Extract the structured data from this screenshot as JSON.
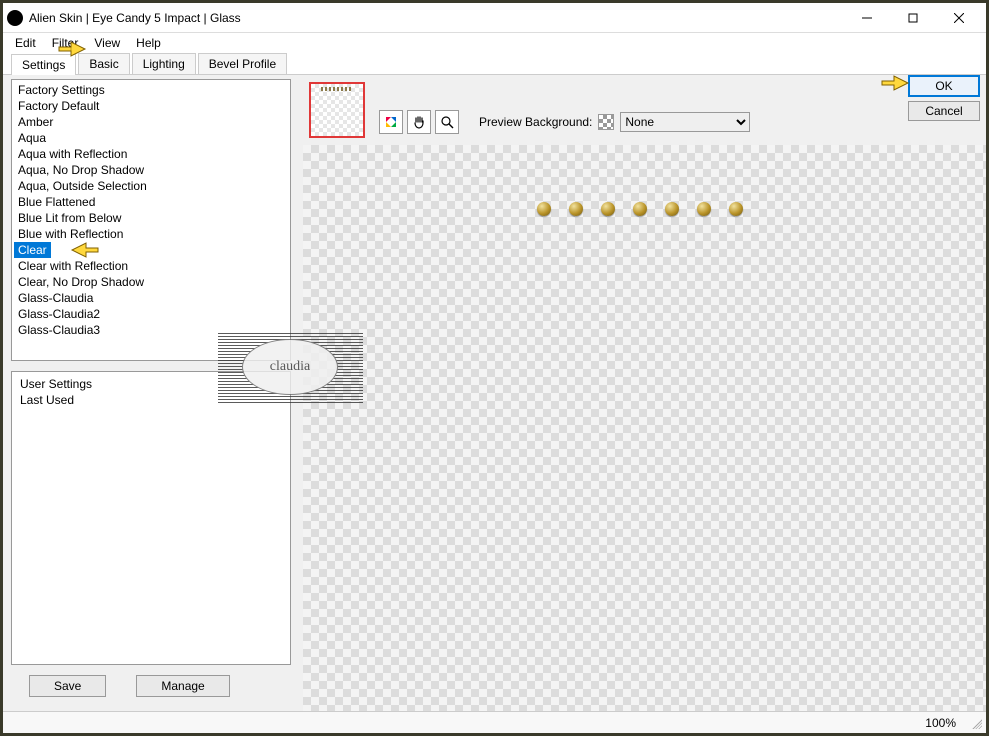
{
  "window": {
    "title": "Alien Skin | Eye Candy 5 Impact | Glass"
  },
  "menu": {
    "items": [
      "Edit",
      "Filter",
      "View",
      "Help"
    ]
  },
  "tabs": {
    "items": [
      "Settings",
      "Basic",
      "Lighting",
      "Bevel Profile"
    ],
    "active": 0
  },
  "preset_list": {
    "header": "Factory Settings",
    "items": [
      "Factory Default",
      "Amber",
      "Aqua",
      "Aqua with Reflection",
      "Aqua, No Drop Shadow",
      "Aqua, Outside Selection",
      "Blue Flattened",
      "Blue Lit from Below",
      "Blue with Reflection",
      "Clear",
      "Clear with Reflection",
      "Clear, No Drop Shadow",
      "Glass-Claudia",
      "Glass-Claudia2",
      "Glass-Claudia3"
    ],
    "selected_index": 9
  },
  "user_settings": {
    "header": "User Settings",
    "items": [
      "Last Used"
    ]
  },
  "buttons": {
    "save": "Save",
    "manage": "Manage",
    "ok": "OK",
    "cancel": "Cancel"
  },
  "preview": {
    "bg_label": "Preview Background:",
    "bg_value": "None",
    "tools": [
      "color-picker",
      "pan-hand",
      "zoom-magnifier"
    ]
  },
  "status": {
    "zoom": "100%"
  },
  "watermark": "claudia"
}
